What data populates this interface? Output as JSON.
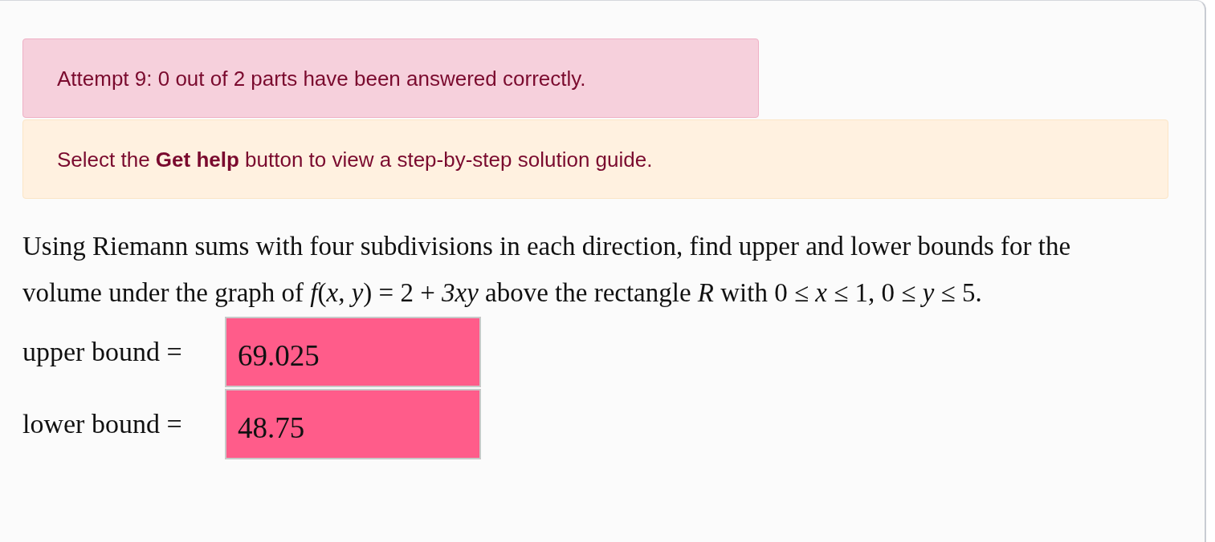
{
  "alerts": [
    {
      "kind": "danger",
      "text": "Attempt 9: 0 out of 2 parts have been answered correctly."
    },
    {
      "kind": "warning",
      "text": "Select the **Get help** button to view a step-by-step solution guide."
    }
  ],
  "problem": {
    "text": "Using Riemann sums with four subdivisions in each direction, find upper and lower bounds for the volume under the graph of *f*(*x*, *y*) = 2 + *3xy* above the rectangle *R* with 0 ≤ *x* ≤ 1,    0 ≤ *y* ≤ 5."
  },
  "answers": [
    {
      "label": "upper bound =",
      "value": "69.025",
      "correct": false
    },
    {
      "label": "lower bound =",
      "value": "48.75",
      "correct": false
    }
  ]
}
